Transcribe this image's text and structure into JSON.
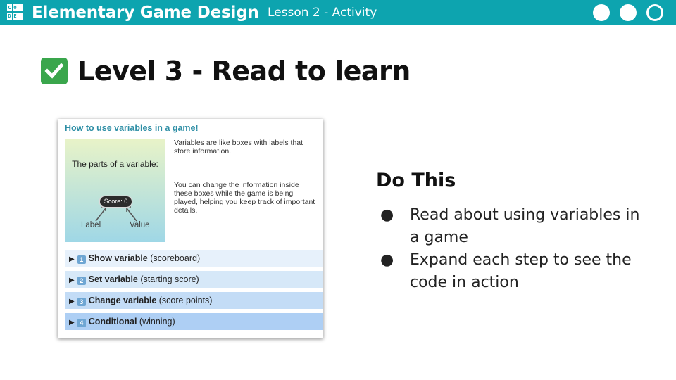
{
  "topbar": {
    "logo_letters": [
      "C",
      "O",
      "D",
      "E",
      " ",
      "E"
    ],
    "logo_name": "code-logo",
    "title": "Elementary Game Design",
    "lesson": "Lesson 2 - Activity",
    "progress_dots": [
      "filled",
      "filled",
      "hollow"
    ],
    "accent_color": "#0da4af"
  },
  "heading": {
    "icon": "checkmark-icon",
    "text": "Level 3 - Read to learn"
  },
  "panel": {
    "title": "How to use variables in a game!",
    "diagram": {
      "title": "The parts of a variable:",
      "pill": "Score: 0",
      "label_left": "Label",
      "label_right": "Value"
    },
    "paragraph1": "Variables are like boxes with labels that store information.",
    "paragraph2": "You can change the information inside these boxes while the game is being played, helping you keep track of important details.",
    "steps": [
      {
        "num": "1",
        "bold": "Show variable",
        "rest": " (scoreboard)",
        "bg": "#e7f1fb"
      },
      {
        "num": "2",
        "bold": "Set variable",
        "rest": " (starting score)",
        "bg": "#d6e8f8"
      },
      {
        "num": "3",
        "bold": "Change variable",
        "rest": " (score points)",
        "bg": "#c3dcf6"
      },
      {
        "num": "4",
        "bold": "Conditional",
        "rest": " (winning)",
        "bg": "#aecff4"
      }
    ]
  },
  "do_this": {
    "title": "Do This",
    "bullets": [
      "Read about using variables in a game",
      "Expand each step to see the code in action"
    ]
  }
}
